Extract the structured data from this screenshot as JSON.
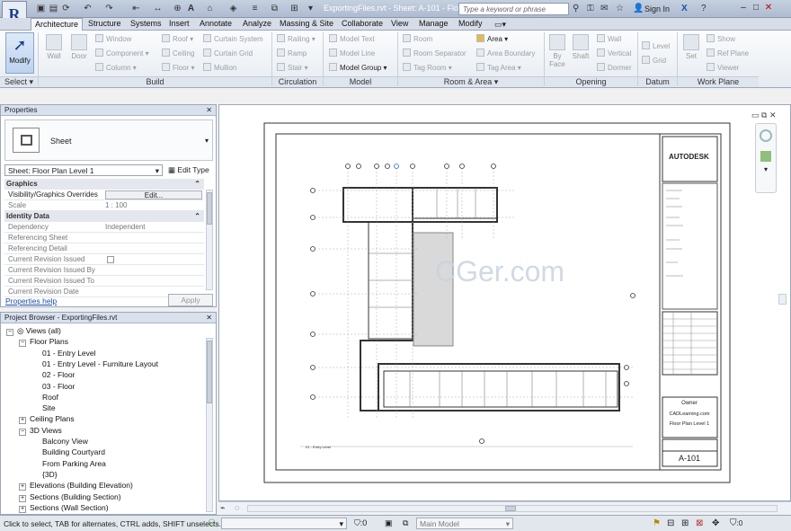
{
  "app": {
    "logo": "R",
    "title": "ExportingFiles.rvt - Sheet: A-101 - Flo...",
    "search_placeholder": "Type a keyword or phrase",
    "signin": "Sign In"
  },
  "tabs": [
    "Architecture",
    "Structure",
    "Systems",
    "Insert",
    "Annotate",
    "Analyze",
    "Massing & Site",
    "Collaborate",
    "View",
    "Manage",
    "Modify"
  ],
  "ribbon": {
    "select": {
      "modify": "Modify",
      "label": "Select ▾"
    },
    "build": {
      "label": "Build",
      "wall": "Wall",
      "door": "Door",
      "window": "Window",
      "component": "Component",
      "column": "Column",
      "roof": "Roof",
      "ceiling": "Ceiling",
      "floor": "Floor",
      "curtain_system": "Curtain System",
      "curtain_grid": "Curtain Grid",
      "mullion": "Mullion"
    },
    "circulation": {
      "label": "Circulation",
      "railing": "Railing",
      "ramp": "Ramp",
      "stair": "Stair"
    },
    "model": {
      "label": "Model",
      "text": "Model Text",
      "line": "Model Line",
      "group": "Model Group"
    },
    "room": {
      "label": "Room & Area ▾",
      "room": "Room",
      "separator": "Room Separator",
      "tag_room": "Tag Room",
      "area": "Area",
      "area_boundary": "Area Boundary",
      "tag_area": "Tag Area"
    },
    "opening": {
      "label": "Opening",
      "by_face": "By Face",
      "shaft": "Shaft",
      "wall": "Wall",
      "vertical": "Vertical",
      "dormer": "Dormer"
    },
    "datum": {
      "label": "Datum",
      "level": "Level",
      "grid": "Grid"
    },
    "workplane": {
      "label": "Work Plane",
      "set": "Set",
      "show": "Show",
      "ref_plane": "Ref Plane",
      "viewer": "Viewer"
    }
  },
  "properties": {
    "header": "Properties",
    "type_name": "Sheet",
    "selector": "Sheet: Floor Plan Level 1",
    "edit_type": "Edit Type",
    "graphics": "Graphics",
    "vg_overrides": "Visibility/Graphics Overrides",
    "edit_btn": "Edit...",
    "scale_k": "Scale",
    "scale_v": "1 : 100",
    "identity": "Identity Data",
    "rows": [
      {
        "k": "Dependency",
        "v": "Independent"
      },
      {
        "k": "Referencing Sheet",
        "v": ""
      },
      {
        "k": "Referencing Detail",
        "v": ""
      },
      {
        "k": "Current Revision Issued",
        "v": ""
      },
      {
        "k": "Current Revision Issued By",
        "v": ""
      },
      {
        "k": "Current Revision Issued To",
        "v": ""
      },
      {
        "k": "Current Revision Date",
        "v": ""
      }
    ],
    "help": "Properties help",
    "apply": "Apply"
  },
  "browser": {
    "header": "Project Browser - ExportingFiles.rvt",
    "items": [
      {
        "label": "Views (all)",
        "level": 0,
        "toggle": "−"
      },
      {
        "label": "Floor Plans",
        "level": 1,
        "toggle": "−"
      },
      {
        "label": "01 - Entry Level",
        "level": 2,
        "toggle": ""
      },
      {
        "label": "01 - Entry Level - Furniture Layout",
        "level": 2,
        "toggle": ""
      },
      {
        "label": "02 - Floor",
        "level": 2,
        "toggle": ""
      },
      {
        "label": "03 - Floor",
        "level": 2,
        "toggle": ""
      },
      {
        "label": "Roof",
        "level": 2,
        "toggle": ""
      },
      {
        "label": "Site",
        "level": 2,
        "toggle": ""
      },
      {
        "label": "Ceiling Plans",
        "level": 1,
        "toggle": "+"
      },
      {
        "label": "3D Views",
        "level": 1,
        "toggle": "−"
      },
      {
        "label": "Balcony View",
        "level": 2,
        "toggle": ""
      },
      {
        "label": "Building Courtyard",
        "level": 2,
        "toggle": ""
      },
      {
        "label": "From Parking Area",
        "level": 2,
        "toggle": ""
      },
      {
        "label": "{3D}",
        "level": 2,
        "toggle": ""
      },
      {
        "label": "Elevations (Building Elevation)",
        "level": 1,
        "toggle": "+"
      },
      {
        "label": "Sections (Building Section)",
        "level": 1,
        "toggle": "+"
      },
      {
        "label": "Sections (Wall Section)",
        "level": 1,
        "toggle": "+"
      }
    ]
  },
  "sheet": {
    "brand": "AUTODESK",
    "owner": "Owner",
    "company": "CADLearning.com",
    "sheet_title": "Floor Plan Level 1",
    "sheet_number": "A-101",
    "level_note": "01 - Entry Level",
    "watermark": "CGer.com"
  },
  "status": {
    "hint": "Click to select, TAB for alternates, CTRL adds, SHIFT unselects.",
    "zero": ":0",
    "model": "Main Model"
  }
}
